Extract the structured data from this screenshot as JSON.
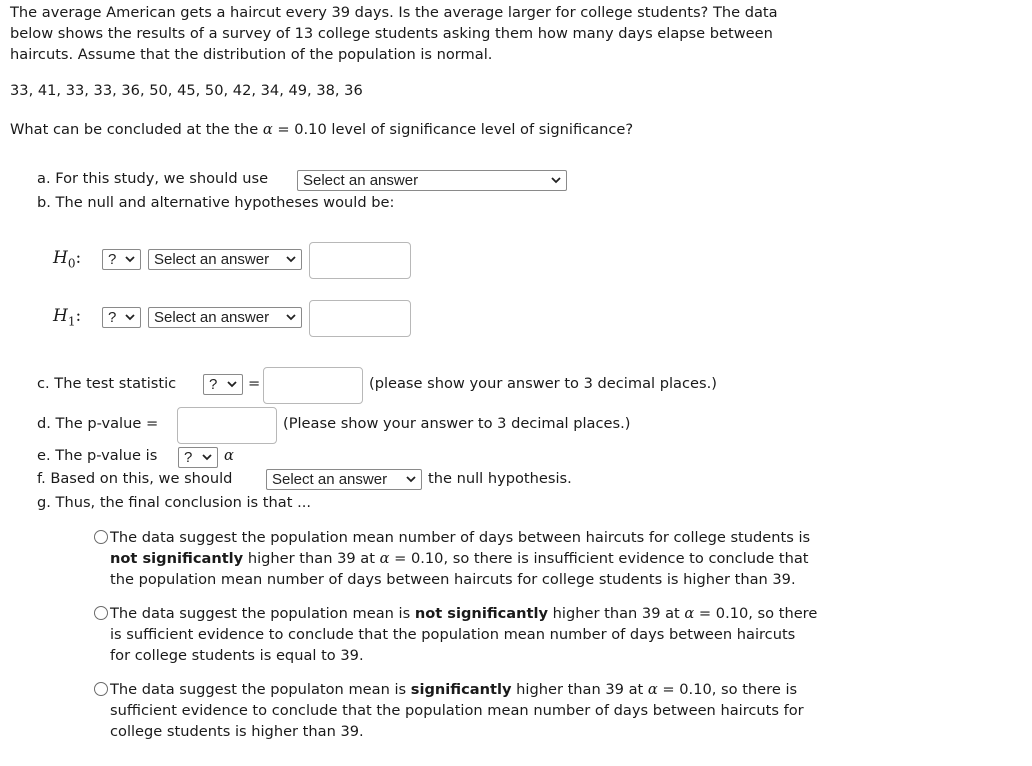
{
  "intro": {
    "line1": "The average American gets a haircut every 39 days. Is the average larger for college students? The data",
    "line2": "below shows the results of a survey of 13 college students asking them how many days elapse between",
    "line3": "haircuts. Assume that the distribution of the population is normal."
  },
  "data_values": "33, 41, 33, 33, 36, 50, 45, 50, 42, 34, 49, 38, 36",
  "question": {
    "prefix": "What can be concluded at the the ",
    "alpha": "α",
    "suffix": " = 0.10 level of significance level of significance?"
  },
  "part_a": {
    "label": "a. For this study, we should use",
    "select": "Select an answer"
  },
  "part_b": {
    "label": "b. The null and alternative hypotheses would be:"
  },
  "h0": {
    "symbol": "H",
    "sub": "0",
    "colon": ":",
    "op_select": "?",
    "param_select": "Select an answer",
    "value": ""
  },
  "h1": {
    "symbol": "H",
    "sub": "1",
    "colon": ":",
    "op_select": "?",
    "param_select": "Select an answer",
    "value": ""
  },
  "part_c": {
    "label": "c. The test statistic",
    "stat_select": "?",
    "equals": "=",
    "value": "",
    "note": "(please show your answer to 3 decimal places.)"
  },
  "part_d": {
    "label": "d. The p-value =",
    "value": "",
    "note": "(Please show your answer to 3 decimal places.)"
  },
  "part_e": {
    "label": "e. The p-value is",
    "compare_select": "?",
    "alpha": "α"
  },
  "part_f": {
    "label": "f. Based on this, we should",
    "select": "Select an answer",
    "suffix": "the null hypothesis."
  },
  "part_g": {
    "label": "g. Thus, the final conclusion is that ..."
  },
  "options": [
    {
      "l1a": "The data suggest the population mean number of days between haircuts for college students is",
      "l2bold": "not significantly",
      "l2a": " higher than 39 at ",
      "alpha": "α",
      "l2b": " = 0.10, so there is insufficient evidence to conclude that",
      "l3": "the population mean number of days between haircuts for college students is higher than 39.",
      "selected": false
    },
    {
      "l1a": "The data suggest the population mean is ",
      "l1bold": "not significantly",
      "l1b": " higher than 39 at ",
      "alpha": "α",
      "l1c": " = 0.10, so there",
      "l2": "is sufficient evidence to conclude that the population mean number of days between haircuts",
      "l3": "for college students is equal to 39.",
      "selected": false
    },
    {
      "l1a": "The data suggest the populaton mean is ",
      "l1bold": "significantly",
      "l1b": " higher than 39 at ",
      "alpha": "α",
      "l1c": " = 0.10, so there is",
      "l2": "sufficient evidence to conclude that the population mean number of days between haircuts for",
      "l3": "college students is higher than 39.",
      "selected": false
    }
  ]
}
